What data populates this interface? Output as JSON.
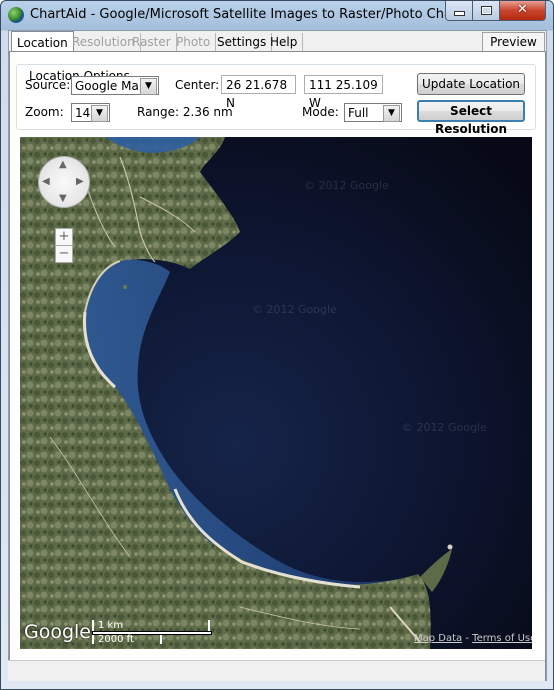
{
  "window": {
    "title": "ChartAid - Google/Microsoft Satellite Images to Raster/Photo Charts",
    "min_label": "",
    "max_label": "",
    "close_label": "✕"
  },
  "tabs": [
    {
      "label": "Location",
      "state": "active"
    },
    {
      "label": "Resolution",
      "state": "disabled"
    },
    {
      "label": "Raster",
      "state": "disabled"
    },
    {
      "label": "Photo",
      "state": "disabled"
    },
    {
      "label": "Settings",
      "state": "enabled"
    },
    {
      "label": "Help",
      "state": "enabled"
    }
  ],
  "preview_label": "Preview",
  "location_options": {
    "group_title": "Location Options",
    "source_label": "Source:",
    "source_value": "Google Maps",
    "center_label": "Center:",
    "center_lat": "26 21.678 N",
    "center_lon": "111 25.109 W",
    "update_button": "Update Location",
    "zoom_label": "Zoom:",
    "zoom_value": "14",
    "range_text": "Range: 2.36 nm",
    "mode_label": "Mode:",
    "mode_value": "Full",
    "select_resolution_button": "Select Resolution"
  },
  "map": {
    "logo": "Google",
    "scale_km": "1 km",
    "scale_ft": "2000 ft",
    "map_data": "Map Data",
    "separator": "-",
    "terms": "Terms of Use",
    "zoom_in": "+",
    "zoom_out": "−",
    "watermark": "© 2012 Google",
    "colors": {
      "sea_deep": "#0b0f1f",
      "sea_shallow": "#2b5aa0",
      "land": "#5b6a48",
      "beach": "#d9d6c8"
    }
  }
}
